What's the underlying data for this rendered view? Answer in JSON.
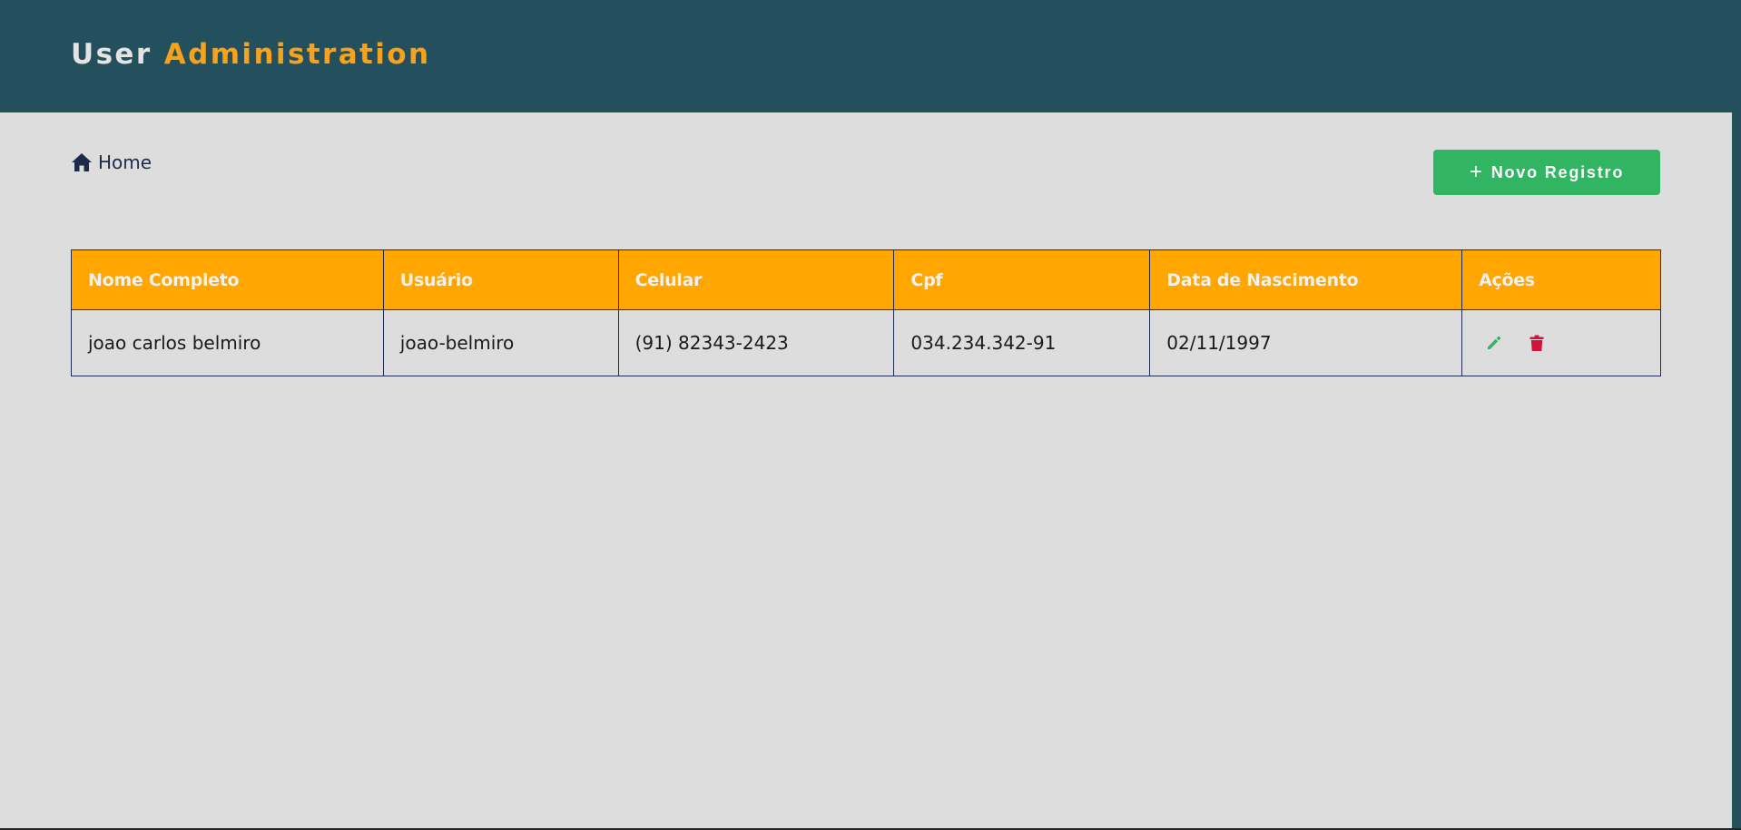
{
  "header": {
    "title_part1": "User",
    "title_part2": "Administration"
  },
  "breadcrumb": {
    "home_icon": "home-icon",
    "label": "Home"
  },
  "toolbar": {
    "new_icon": "plus-icon",
    "new_label": "Novo Registro"
  },
  "table": {
    "columns": [
      "Nome Completo",
      "Usuário",
      "Celular",
      "Cpf",
      "Data de Nascimento",
      "Ações"
    ],
    "rows": [
      {
        "nome": "joao carlos belmiro",
        "usuario": "joao-belmiro",
        "celular": "(91) 82343-2423",
        "cpf": "034.234.342-91",
        "nascimento": "02/11/1997",
        "actions": [
          "pencil-icon",
          "trash-icon"
        ]
      }
    ]
  },
  "colors": {
    "header_bg": "#244f5c",
    "accent": "#f7a21c",
    "table_header": "#ffa600",
    "success": "#32b562",
    "danger": "#d0123c",
    "page_bg": "#dddddd"
  }
}
